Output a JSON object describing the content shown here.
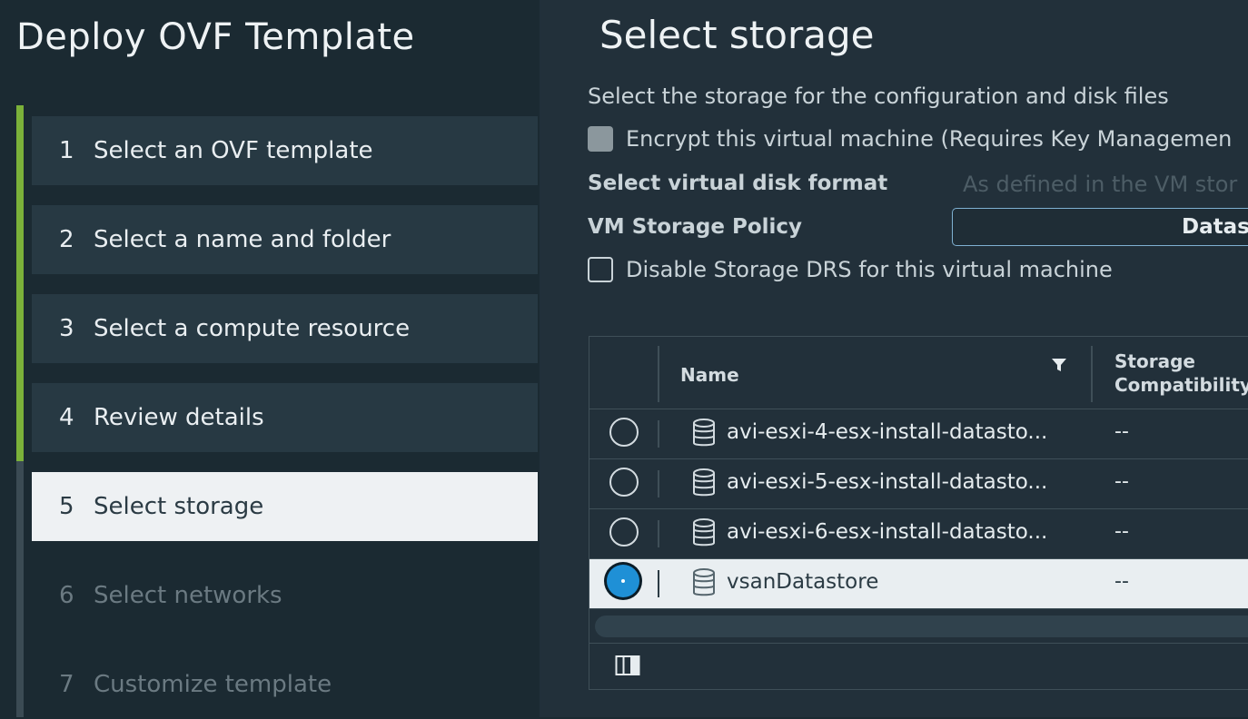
{
  "wizard": {
    "title": "Deploy OVF Template",
    "steps": [
      {
        "num": "1",
        "label": "Select an OVF template"
      },
      {
        "num": "2",
        "label": "Select a name and folder"
      },
      {
        "num": "3",
        "label": "Select a compute resource"
      },
      {
        "num": "4",
        "label": "Review details"
      },
      {
        "num": "5",
        "label": "Select storage"
      },
      {
        "num": "6",
        "label": "Select networks"
      },
      {
        "num": "7",
        "label": "Customize template"
      }
    ]
  },
  "page": {
    "title": "Select storage",
    "subtitle": "Select the storage for the configuration and disk files",
    "encrypt_label": "Encrypt this virtual machine (Requires Key Managemen",
    "disk_format_label": "Select virtual disk format",
    "disk_format_value": "As defined in the VM stor",
    "policy_label": "VM Storage Policy",
    "policy_value": "Datas",
    "disable_drs_label": "Disable Storage DRS for this virtual machine"
  },
  "table": {
    "columns": [
      "Name",
      "Storage\nCompatibility"
    ],
    "rows": [
      {
        "name": "avi-esxi-4-esx-install-datasto...",
        "compat": "--",
        "selected": false
      },
      {
        "name": "avi-esxi-5-esx-install-datasto...",
        "compat": "--",
        "selected": false
      },
      {
        "name": "avi-esxi-6-esx-install-datasto...",
        "compat": "--",
        "selected": false
      },
      {
        "name": "vsanDatastore",
        "compat": "--",
        "selected": true
      }
    ]
  },
  "colors": {
    "accent_done": "#7bb13a",
    "radio_selected": "#1f90d6"
  },
  "icons": {
    "filter": "filter-icon",
    "datastore": "database-icon",
    "columns": "column-toggle-icon"
  }
}
